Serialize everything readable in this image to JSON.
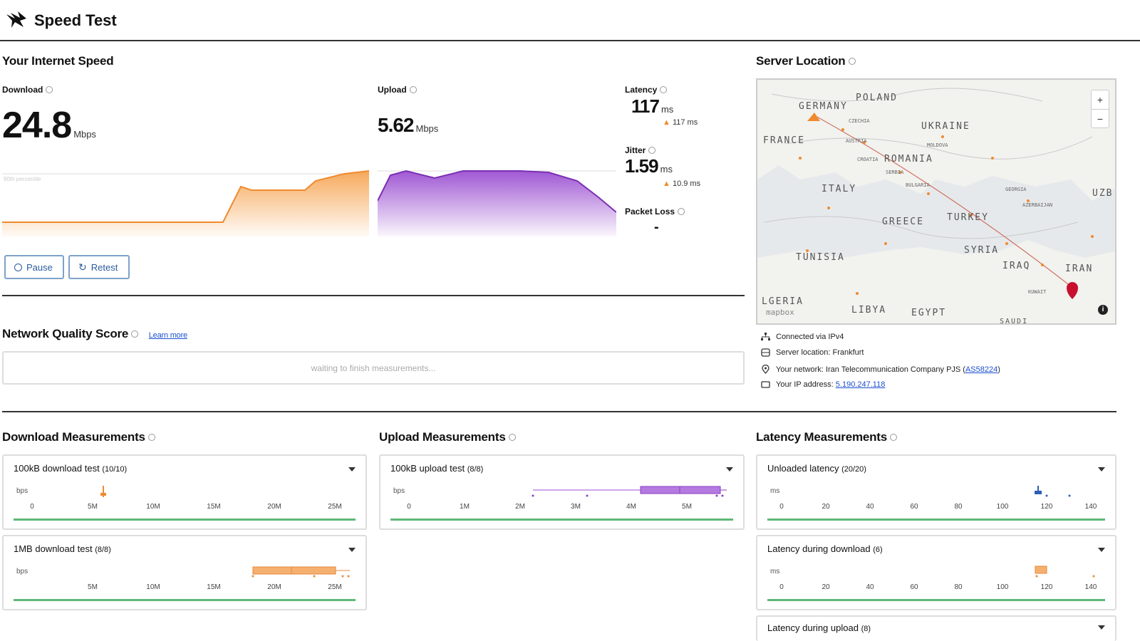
{
  "app": {
    "title": "Speed Test"
  },
  "speed": {
    "section_title": "Your Internet Speed",
    "download": {
      "label": "Download",
      "value": "24.8",
      "unit": "Mbps",
      "percentile_label": "90th percentile"
    },
    "upload": {
      "label": "Upload",
      "value": "5.62",
      "unit": "Mbps"
    },
    "latency": {
      "label": "Latency",
      "value": "117",
      "unit": "ms",
      "sub": "117 ms"
    },
    "jitter": {
      "label": "Jitter",
      "value": "1.59",
      "unit": "ms",
      "sub": "10.9 ms"
    },
    "packet_loss": {
      "label": "Packet Loss",
      "value": "-"
    },
    "buttons": {
      "pause": "Pause",
      "retest": "Retest"
    }
  },
  "network_quality": {
    "title": "Network Quality Score",
    "learn_more": "Learn more",
    "waiting": "waiting to finish measurements..."
  },
  "server": {
    "title": "Server Location",
    "connected": "Connected via IPv4",
    "server_location": "Server location: Frankfurt",
    "network_prefix": "Your network: Iran Telecommunication Company PJS (",
    "network_as": "AS58224",
    "network_suffix": ")",
    "ip_prefix": "Your IP address: ",
    "ip": "5.190.247.118",
    "map_labels": {
      "germany": "GERMANY",
      "poland": "POLAND",
      "ukraine": "UKRAINE",
      "france": "FRANCE",
      "romania": "ROMANIA",
      "italy": "ITALY",
      "greece": "GREECE",
      "turkey": "TURKEY",
      "syria": "SYRIA",
      "tunisia": "TUNISIA",
      "iraq": "IRAQ",
      "iran": "IRAN",
      "algeria": "LGERIA",
      "libya": "LIBYA",
      "egypt": "EGYPT",
      "uzb": "UZB",
      "czechia": "CZECHIA",
      "austria": "AUSTRIA",
      "moldova": "MOLDOVA",
      "croatia": "CROATIA",
      "serbia": "SERBIA",
      "bulgaria": "BULGARIA",
      "georgia": "GEORGIA",
      "azerbaijan": "AZERBAIJAN",
      "kuwait": "KUWAIT",
      "saudi": "SAUDI",
      "mapbox": "mapbox"
    },
    "zoom_in": "+",
    "zoom_out": "−"
  },
  "download_measurements": {
    "title": "Download Measurements",
    "tests": [
      {
        "name": "100kB download test",
        "count": "(10/10)",
        "unit": "bps",
        "ticks": [
          "0",
          "5M",
          "10M",
          "15M",
          "20M",
          "25M"
        ]
      },
      {
        "name": "1MB download test",
        "count": "(8/8)",
        "unit": "bps",
        "ticks": [
          "5M",
          "10M",
          "15M",
          "20M",
          "25M"
        ]
      }
    ]
  },
  "upload_measurements": {
    "title": "Upload Measurements",
    "tests": [
      {
        "name": "100kB upload test",
        "count": "(8/8)",
        "unit": "bps",
        "ticks": [
          "0",
          "1M",
          "2M",
          "3M",
          "4M",
          "5M"
        ]
      }
    ]
  },
  "latency_measurements": {
    "title": "Latency Measurements",
    "tests": [
      {
        "name": "Unloaded latency",
        "count": "(20/20)",
        "unit": "ms",
        "ticks": [
          "0",
          "20",
          "40",
          "60",
          "80",
          "100",
          "120",
          "140"
        ]
      },
      {
        "name": "Latency during download",
        "count": "(6)",
        "unit": "ms",
        "ticks": [
          "0",
          "20",
          "40",
          "60",
          "80",
          "100",
          "120",
          "140"
        ]
      },
      {
        "name": "Latency during upload",
        "count": "(8)"
      }
    ]
  },
  "colors": {
    "download": "#f5a04a",
    "upload": "#9b4fd1",
    "green": "#5fb878",
    "link": "#1a4fd1",
    "pin": "#c8102e"
  }
}
